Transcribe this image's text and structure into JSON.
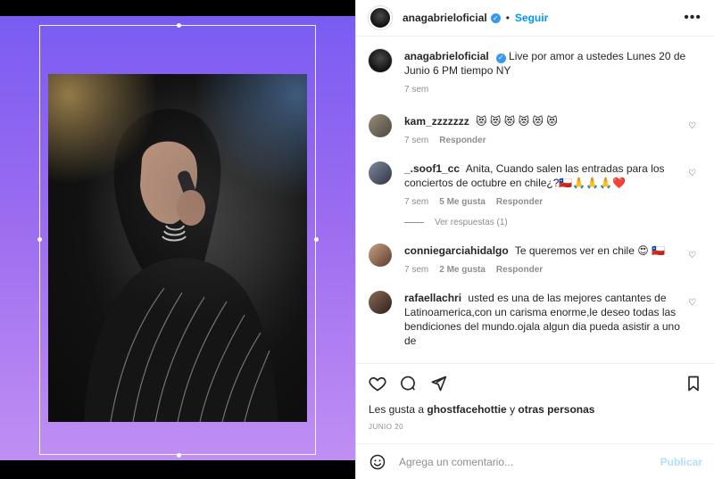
{
  "header": {
    "username": "anagabrieloficial",
    "follow_label": "Seguir",
    "more_label": "•••"
  },
  "caption": {
    "username": "anagabrieloficial",
    "text": "Live por amor a ustedes Lunes 20 de Junio 6 PM tiempo NY",
    "time": "7 sem"
  },
  "comments": [
    {
      "username": "kam_zzzzzzz",
      "text": "😻 😻 😻 😻 😻 😻",
      "time": "7 sem",
      "likes": "",
      "reply_label": "Responder"
    },
    {
      "username": "_.soof1_cc",
      "text": "Anita, Cuando salen las entradas para los conciertos de octubre en chile¿?🇨🇱🙏🙏🙏❤️",
      "time": "7 sem",
      "likes": "5 Me gusta",
      "reply_label": "Responder",
      "view_replies": "Ver respuestas (1)"
    },
    {
      "username": "conniegarciahidalgo",
      "text": "Te queremos ver en chile 😍 🇨🇱",
      "time": "7 sem",
      "likes": "2 Me gusta",
      "reply_label": "Responder"
    },
    {
      "username": "rafaellachri",
      "text": "usted es una de las mejores cantantes de Latinoamerica,con un carisma enorme,le deseo todas las bendiciones del mundo.ojala algun dia pueda asistir a uno de",
      "time": "",
      "likes": "",
      "reply_label": ""
    }
  ],
  "likes_line": {
    "prefix": "Les gusta a",
    "user": "ghostfacehottie",
    "middle": "y",
    "others": "otras personas"
  },
  "date": "JUNIO 20",
  "add_comment": {
    "placeholder": "Agrega un comentario...",
    "publish_label": "Publicar"
  },
  "icons": {
    "like": "heart-icon",
    "comment": "comment-icon",
    "share": "send-icon",
    "save": "bookmark-icon",
    "emoji": "emoji-icon"
  },
  "colors": {
    "accent": "#0095f6",
    "publish_disabled": "#b2dffc",
    "background_gradient_top": "#7a5cf2",
    "background_gradient_bottom": "#c08ff3"
  }
}
